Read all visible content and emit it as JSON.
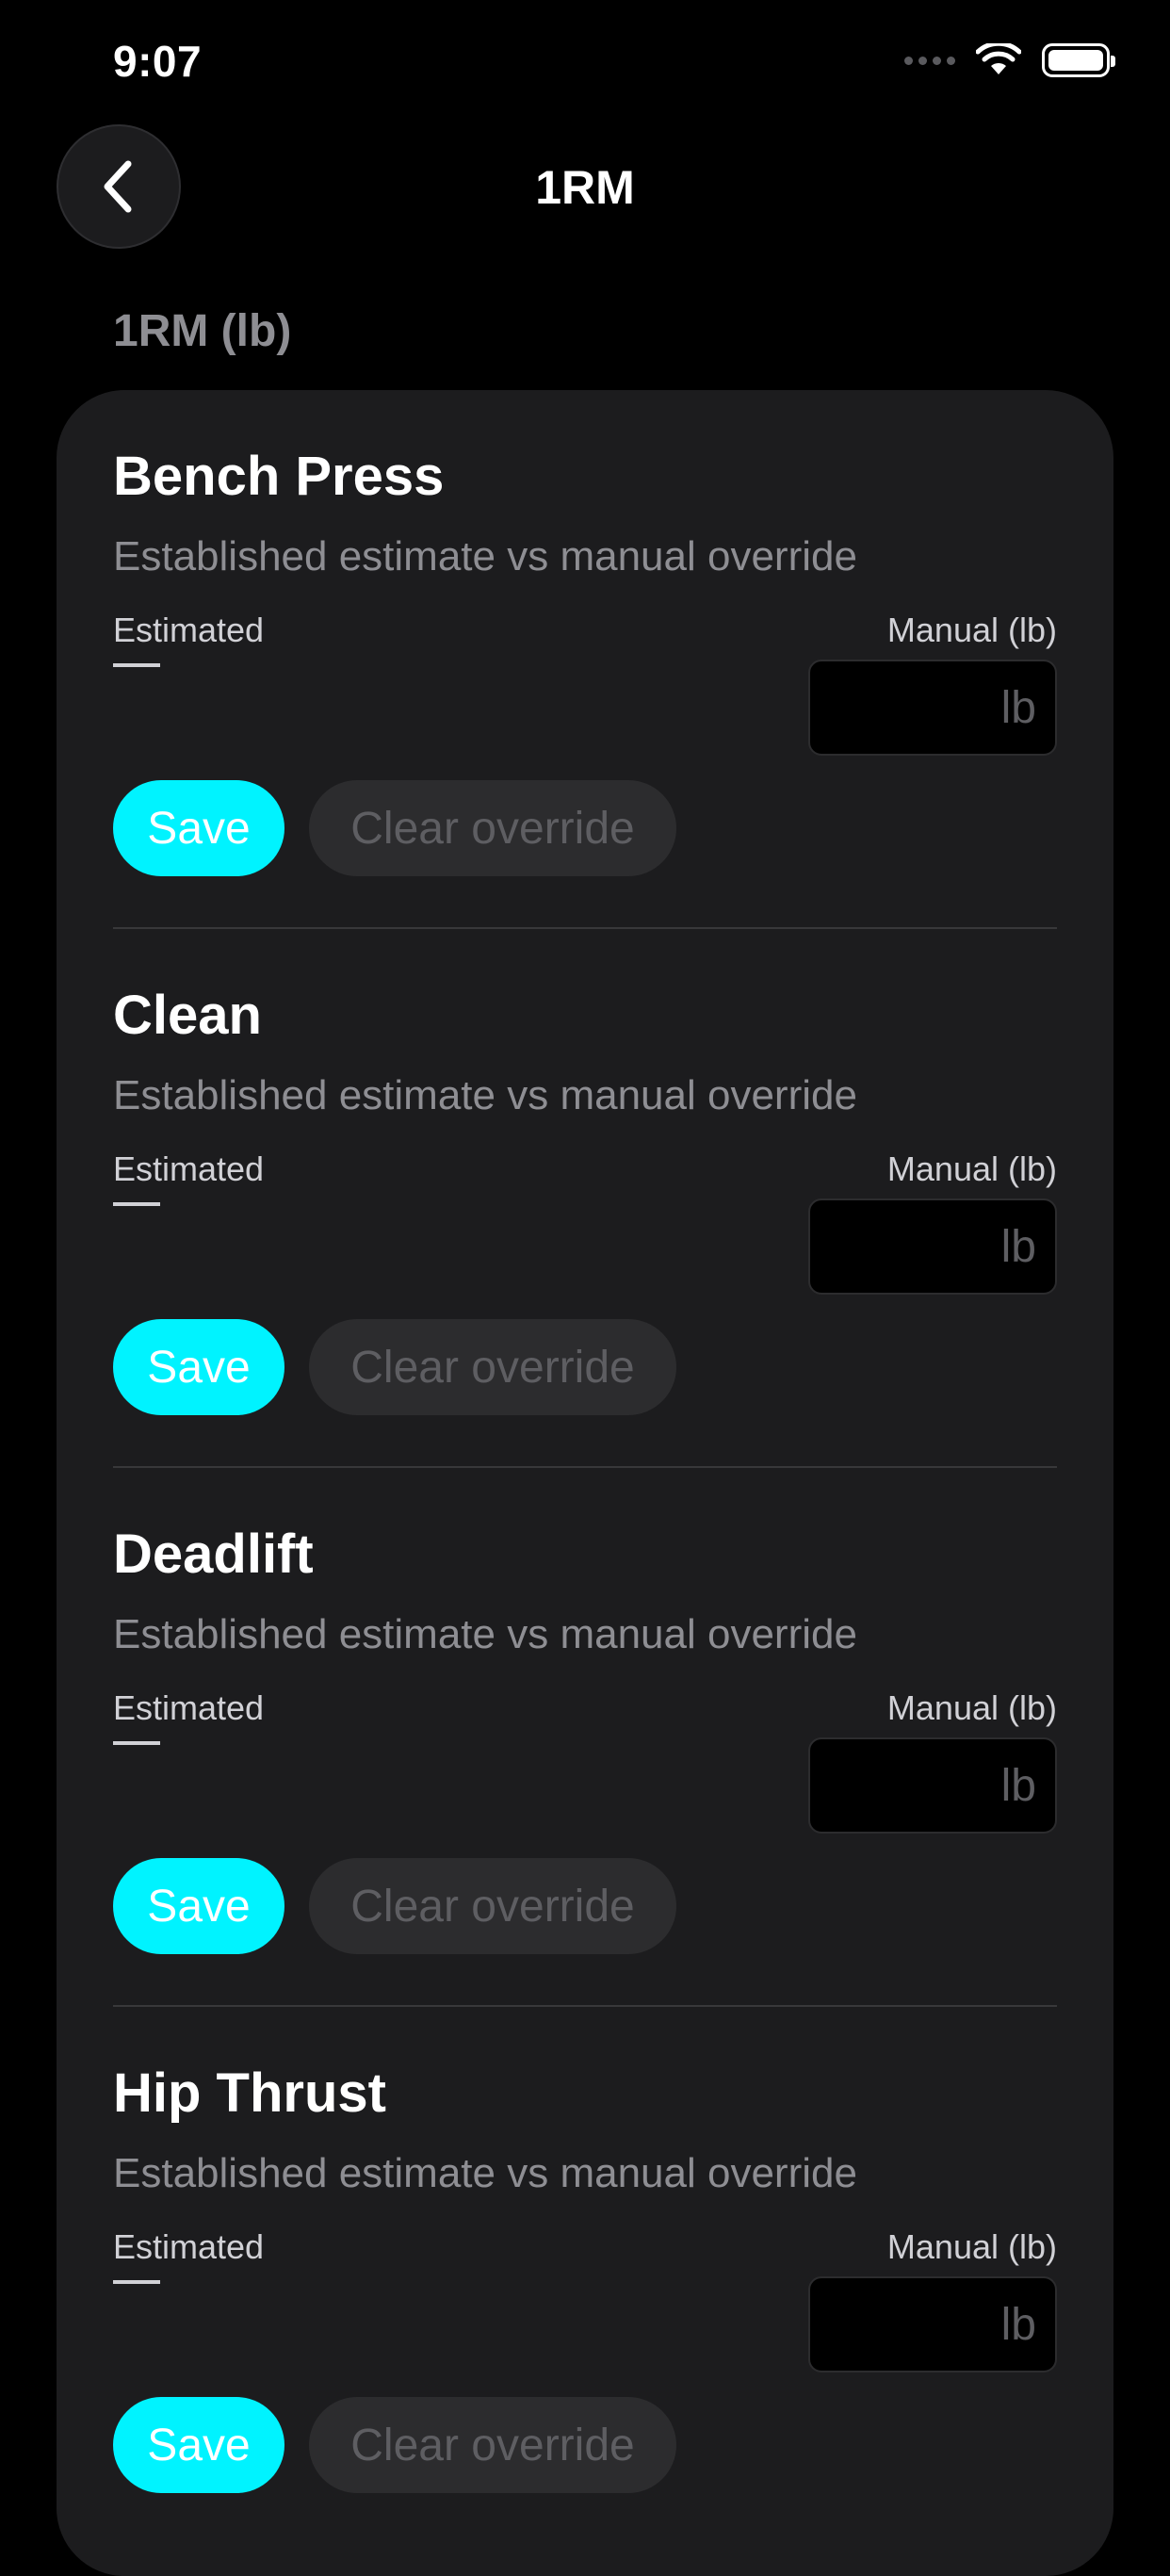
{
  "status": {
    "time": "9:07"
  },
  "nav": {
    "title": "1RM"
  },
  "section": {
    "header": "1RM (lb)"
  },
  "exercises": [
    {
      "name": "Bench Press",
      "subtitle": "Established estimate vs manual override",
      "estimated_label": "Estimated",
      "estimated_value": "—",
      "manual_label": "Manual (lb)",
      "manual_value": "",
      "manual_unit": "lb",
      "save_label": "Save",
      "clear_label": "Clear override"
    },
    {
      "name": "Clean",
      "subtitle": "Established estimate vs manual override",
      "estimated_label": "Estimated",
      "estimated_value": "—",
      "manual_label": "Manual (lb)",
      "manual_value": "",
      "manual_unit": "lb",
      "save_label": "Save",
      "clear_label": "Clear override"
    },
    {
      "name": "Deadlift",
      "subtitle": "Established estimate vs manual override",
      "estimated_label": "Estimated",
      "estimated_value": "—",
      "manual_label": "Manual (lb)",
      "manual_value": "",
      "manual_unit": "lb",
      "save_label": "Save",
      "clear_label": "Clear override"
    },
    {
      "name": "Hip Thrust",
      "subtitle": "Established estimate vs manual override",
      "estimated_label": "Estimated",
      "estimated_value": "—",
      "manual_label": "Manual (lb)",
      "manual_value": "",
      "manual_unit": "lb",
      "save_label": "Save",
      "clear_label": "Clear override"
    }
  ],
  "icons": {
    "back": "chevron-left-icon",
    "signal": "cellular-signal-icon",
    "wifi": "wifi-icon",
    "battery": "battery-icon"
  },
  "colors": {
    "background": "#000000",
    "card": "#1c1c1e",
    "accent": "#00f3ff",
    "secondary_button": "#2c2c2e",
    "muted_text": "#8e8e93"
  }
}
